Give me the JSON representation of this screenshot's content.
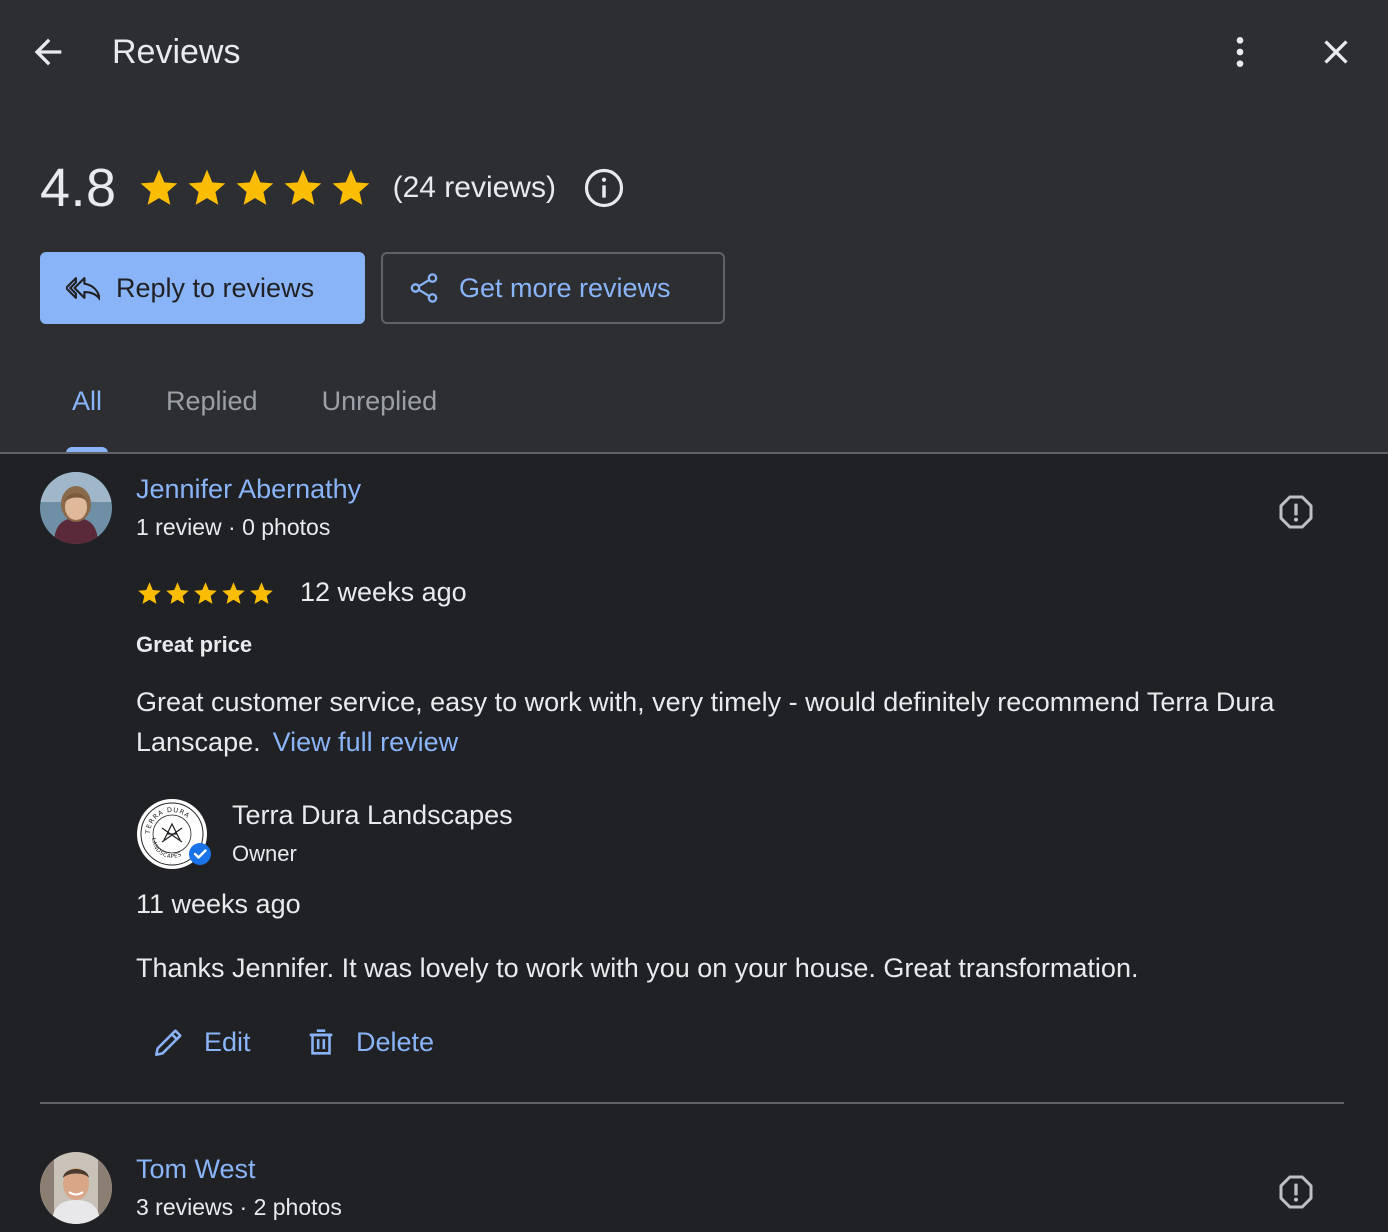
{
  "header": {
    "title": "Reviews",
    "back_icon": "arrow-left-icon",
    "more_icon": "more-vert-icon",
    "close_icon": "close-icon"
  },
  "summary": {
    "average": "4.8",
    "stars": 5,
    "count_text": "(24 reviews)"
  },
  "buttons": {
    "reply": "Reply to reviews",
    "get_more": "Get more reviews"
  },
  "tabs": [
    {
      "label": "All",
      "active": true
    },
    {
      "label": "Replied",
      "active": false
    },
    {
      "label": "Unreplied",
      "active": false
    }
  ],
  "reviews": [
    {
      "name": "Jennifer Abernathy",
      "meta": "1 review · 0 photos",
      "rating": 5,
      "date": "12 weeks ago",
      "title": "Great price",
      "text": "Great customer service, easy to work with, very timely - would definitely recommend Terra Dura Lanscape.",
      "view_full": "View full review",
      "reply": {
        "owner_name": "Terra Dura Landscapes",
        "owner_role": "Owner",
        "date": "11 weeks ago",
        "text": "Thanks Jennifer. It was lovely to work with you on your house. Great transformation.",
        "edit_label": "Edit",
        "delete_label": "Delete",
        "logo_text_top": "TERRA DURA",
        "logo_text_bottom": "LANDSCAPES"
      }
    },
    {
      "name": "Tom West",
      "meta": "3 reviews · 2 photos"
    }
  ],
  "colors": {
    "accent": "#8ab4f8",
    "star": "#fbbc04",
    "header_bg": "#2d2e32",
    "body_bg": "#202124"
  }
}
